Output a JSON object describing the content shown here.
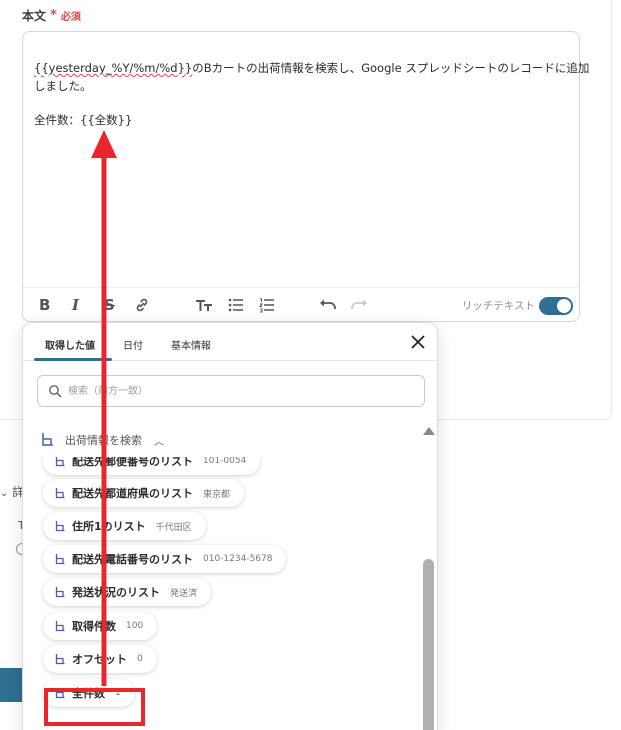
{
  "field": {
    "label": "本文",
    "required_star": "*",
    "required_text": "必須"
  },
  "editor": {
    "line1_var": "{{yesterday_%Y/%m/%d}}",
    "line1_rest": "のBカートの出荷情報を検索し、Google スプレッドシートのレコードに追加",
    "line2": "しました。",
    "line3": "全件数：{{全数}}"
  },
  "toolbar": {
    "icons": [
      "bold-icon",
      "italic-icon",
      "strikethrough-icon",
      "link-icon",
      "text-size-icon",
      "bullet-list-icon",
      "numbered-list-icon",
      "undo-icon",
      "redo-icon"
    ],
    "bold": "B",
    "italic": "I",
    "strike": "S",
    "rich_text_label": "リッチテキスト",
    "rich_text_on": true,
    "toggle_color": "#2f6f8f"
  },
  "popup": {
    "tabs": [
      "取得した値",
      "日付",
      "基本情報"
    ],
    "active_tab": "取得した値",
    "search_placeholder": "検索（前方一致）",
    "group_label": "出荷情報を検索",
    "items": [
      {
        "name": "配送先郵便番号のリスト",
        "value": "101-0054"
      },
      {
        "name": "配送先都道府県のリスト",
        "value": "東京都"
      },
      {
        "name": "住所1のリスト",
        "value": "千代田区"
      },
      {
        "name": "配送先電話番号のリスト",
        "value": "010-1234-5678"
      },
      {
        "name": "発送状況のリスト",
        "value": "発送済"
      },
      {
        "name": "取得件数",
        "value": "100"
      },
      {
        "name": "オフセット",
        "value": "0"
      },
      {
        "name": "全件数",
        "value": "1"
      }
    ]
  },
  "background": {
    "side_text": "詳",
    "side_text2": "T"
  },
  "annotation": {
    "color": "#e8262b",
    "highlighted_item": "全件数"
  }
}
